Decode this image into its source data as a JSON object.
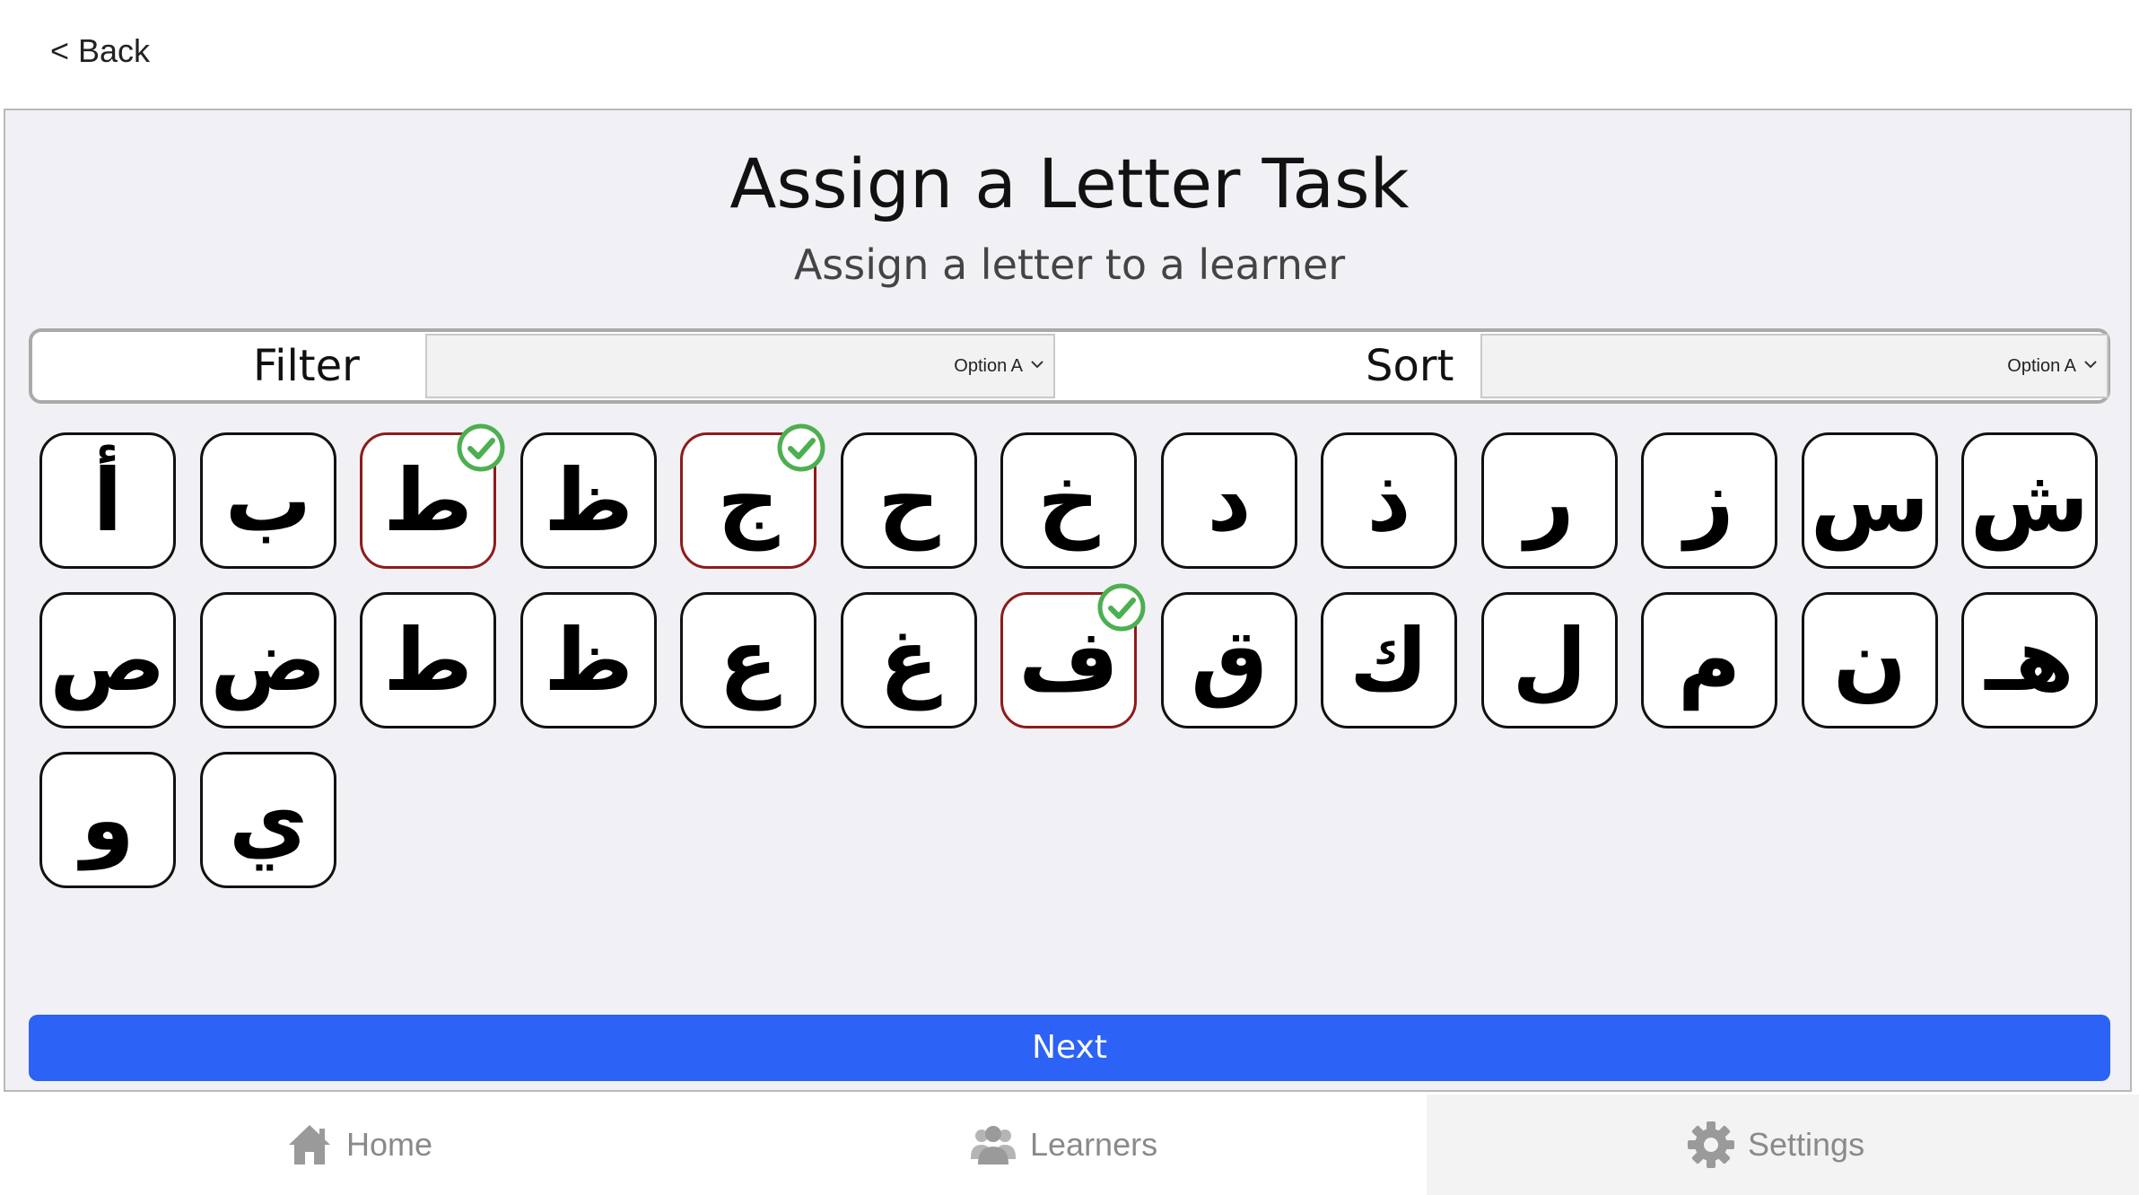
{
  "nav": {
    "back_label": "< Back"
  },
  "header": {
    "title": "Assign a Letter Task",
    "subtitle": "Assign a letter to a learner"
  },
  "controls": {
    "filter_label": "Filter",
    "filter_value": "Option A",
    "sort_label": "Sort",
    "sort_value": "Option A"
  },
  "letters": [
    {
      "char": "أ",
      "selected": false
    },
    {
      "char": "ب",
      "selected": false
    },
    {
      "char": "ط",
      "selected": true
    },
    {
      "char": "ظ",
      "selected": false
    },
    {
      "char": "ج",
      "selected": true
    },
    {
      "char": "ح",
      "selected": false
    },
    {
      "char": "خ",
      "selected": false
    },
    {
      "char": "د",
      "selected": false
    },
    {
      "char": "ذ",
      "selected": false
    },
    {
      "char": "ر",
      "selected": false
    },
    {
      "char": "ز",
      "selected": false
    },
    {
      "char": "س",
      "selected": false
    },
    {
      "char": "ش",
      "selected": false
    },
    {
      "char": "ص",
      "selected": false
    },
    {
      "char": "ض",
      "selected": false
    },
    {
      "char": "ط",
      "selected": false
    },
    {
      "char": "ظ",
      "selected": false
    },
    {
      "char": "ع",
      "selected": false
    },
    {
      "char": "غ",
      "selected": false
    },
    {
      "char": "ف",
      "selected": true
    },
    {
      "char": "ق",
      "selected": false
    },
    {
      "char": "ك",
      "selected": false
    },
    {
      "char": "ل",
      "selected": false
    },
    {
      "char": "م",
      "selected": false
    },
    {
      "char": "ن",
      "selected": false
    },
    {
      "char": "هـ",
      "selected": false
    },
    {
      "char": "و",
      "selected": false
    },
    {
      "char": "ي",
      "selected": false
    }
  ],
  "actions": {
    "next_label": "Next"
  },
  "tabs": [
    {
      "label": "Home",
      "icon": "home-icon"
    },
    {
      "label": "Learners",
      "icon": "learners-icon"
    },
    {
      "label": "Settings",
      "icon": "gear-icon"
    }
  ],
  "colors": {
    "accent": "#2c62f5",
    "selected_border": "#8e1b1b",
    "check": "#4caf50",
    "panel_bg": "#f1f1f5"
  }
}
